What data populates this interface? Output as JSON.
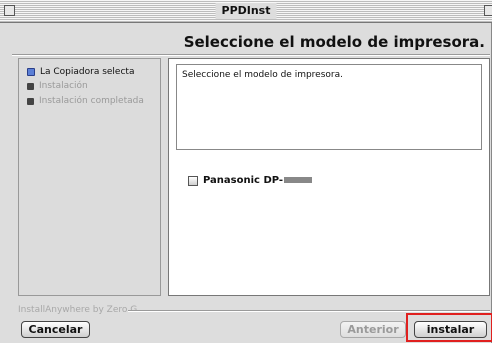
{
  "window": {
    "title": "PPDInst"
  },
  "header": {
    "heading": "Seleccione el modelo de impresora."
  },
  "sidebar": {
    "steps": [
      {
        "label": "La Copiadora selecta",
        "state": "active"
      },
      {
        "label": "Instalación",
        "state": "inactive"
      },
      {
        "label": "Instalación completada",
        "state": "inactive"
      }
    ]
  },
  "main": {
    "instruction": "Seleccione el modelo de impresora.",
    "printer_option": {
      "label": "Panasonic DP-",
      "checked": false
    }
  },
  "footer": {
    "credit": "InstallAnywhere by Zero G",
    "cancel_label": "Cancelar",
    "prev_label": "Anterior",
    "install_label": "instalar"
  },
  "colors": {
    "highlight": "#e0201f",
    "active_bullet": "#5b7fd6"
  }
}
